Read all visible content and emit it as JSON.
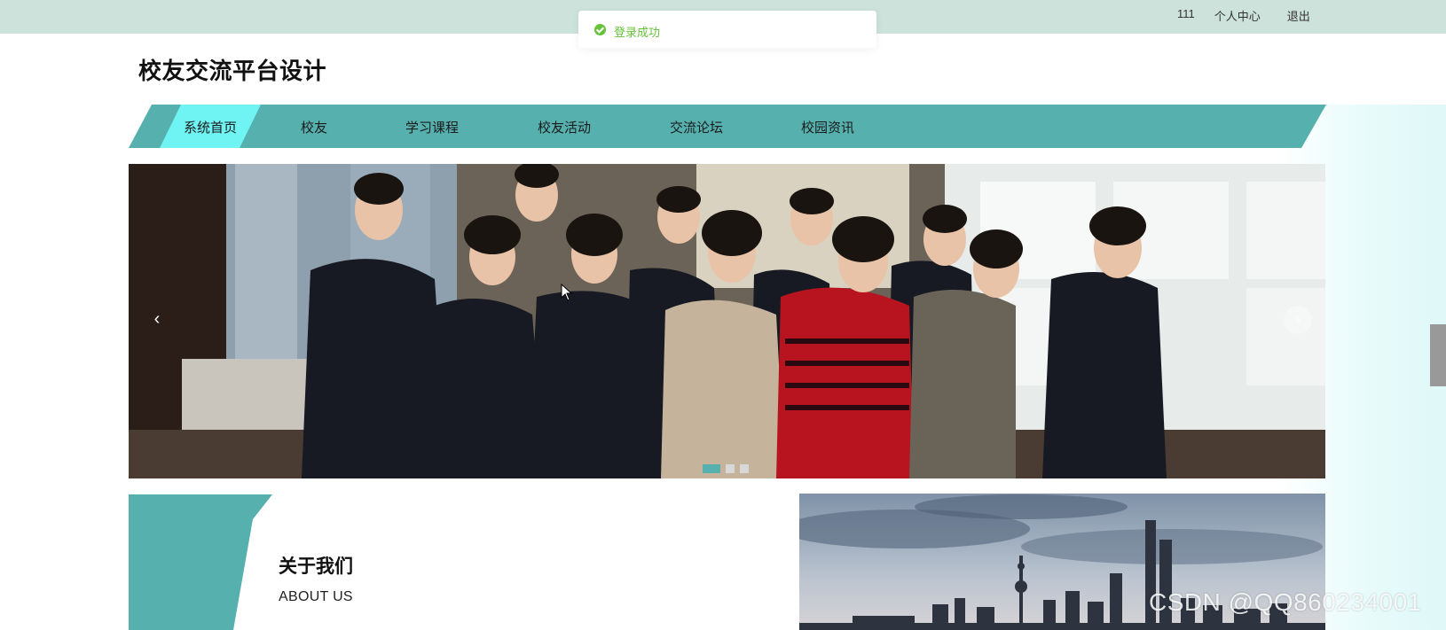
{
  "topbar": {
    "username": "111",
    "profile_label": "个人中心",
    "logout_label": "退出"
  },
  "toast": {
    "message": "登录成功",
    "color": "#67c23a"
  },
  "header": {
    "site_title": "校友交流平台设计"
  },
  "nav": {
    "items": [
      {
        "label": "系统首页",
        "active": true
      },
      {
        "label": "校友",
        "active": false
      },
      {
        "label": "学习课程",
        "active": false
      },
      {
        "label": "校友活动",
        "active": false
      },
      {
        "label": "交流论坛",
        "active": false
      },
      {
        "label": "校园资讯",
        "active": false
      }
    ],
    "accent_color": "#55b0ae",
    "active_color": "#6ff3f3"
  },
  "banner": {
    "prev_label": "‹",
    "next_label": "›",
    "slide_count": 3,
    "active_slide": 1
  },
  "about": {
    "title": "关于我们",
    "subtitle": "ABOUT US"
  },
  "watermark": "CSDN @QQ860234001"
}
